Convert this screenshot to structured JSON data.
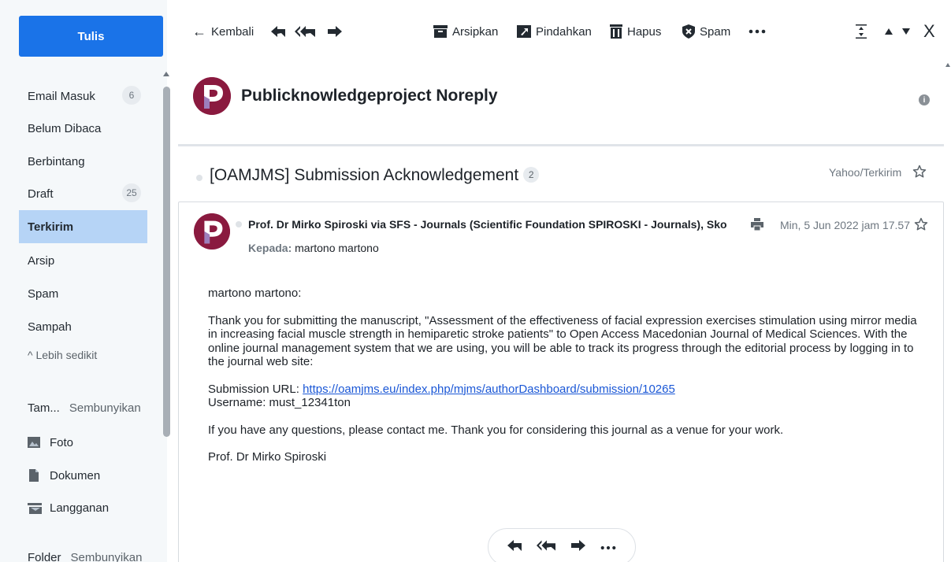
{
  "sidebar": {
    "compose_label": "Tulis",
    "items": [
      {
        "label": "Email Masuk",
        "count": "6"
      },
      {
        "label": "Belum Dibaca",
        "count": ""
      },
      {
        "label": "Berbintang",
        "count": ""
      },
      {
        "label": "Draft",
        "count": "25"
      },
      {
        "label": "Terkirim",
        "count": "",
        "active": true
      },
      {
        "label": "Arsip",
        "count": ""
      },
      {
        "label": "Spam",
        "count": ""
      },
      {
        "label": "Sampah",
        "count": ""
      }
    ],
    "less_label": "^ Lebih sedikit",
    "views_section": {
      "title": "Tam...",
      "action": "Sembunyikan"
    },
    "views": [
      {
        "label": "Foto",
        "icon": "photo-icon"
      },
      {
        "label": "Dokumen",
        "icon": "document-icon"
      },
      {
        "label": "Langganan",
        "icon": "subscription-icon"
      }
    ],
    "folders_section": {
      "title": "Folder",
      "action": "Sembunyikan"
    }
  },
  "toolbar": {
    "back_label": "Kembali",
    "archive_label": "Arsipkan",
    "move_label": "Pindahkan",
    "delete_label": "Hapus",
    "spam_label": "Spam",
    "close_label": "X"
  },
  "header": {
    "sender_name": "Publicknowledgeproject Noreply",
    "avatar_letter": "P"
  },
  "thread": {
    "subject": "[OAMJMS] Submission Acknowledgement",
    "count": "2",
    "folder": "Yahoo/Terkirim"
  },
  "message": {
    "from": "Prof. Dr Mirko Spiroski via SFS - Journals (Scientific Foundation SPIROSKI - Journals), Sko",
    "to_label": "Kepada:",
    "to": "martono martono",
    "date": "Min, 5 Jun 2022 jam 17.57",
    "avatar_letter": "P",
    "greeting": "martono martono:",
    "paragraph1": "Thank you for submitting the manuscript, \"Assessment of the effectiveness of facial expression exercises stimulation using mirror media in increasing facial muscle strength in hemiparetic stroke patients\" to Open Access Macedonian Journal of Medical Sciences. With the online journal management system that we are using, you will be able to track its progress through the editorial process by logging in to the journal web site:",
    "url_label": "Submission URL:",
    "url": "https://oamjms.eu/index.php/mjms/authorDashboard/submission/10265",
    "username_line": "Username: must_12341ton",
    "paragraph2": "If you have any questions, please contact me. Thank you for considering this journal as a venue for your work.",
    "signature": "Prof. Dr Mirko Spiroski"
  },
  "colors": {
    "accent": "#1a73e8",
    "active_folder": "#b6d4f6",
    "avatar": "#8a1a3f",
    "link": "#1a57d6"
  }
}
